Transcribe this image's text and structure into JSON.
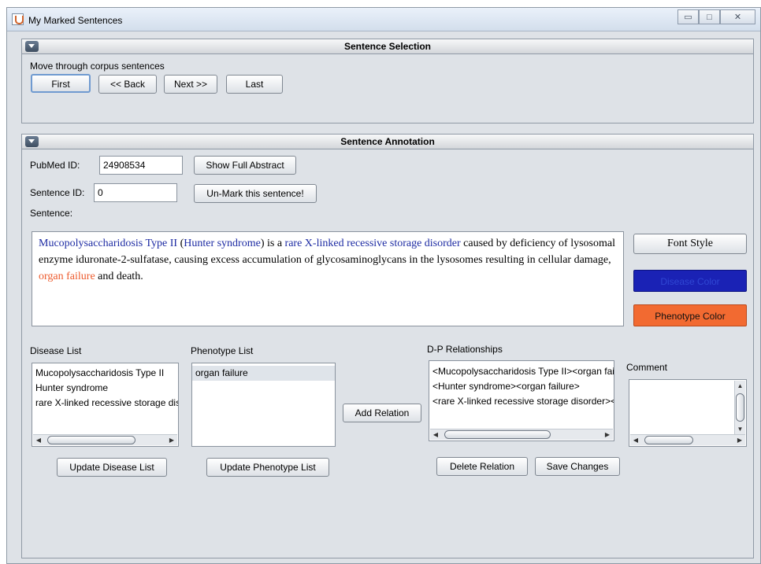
{
  "window": {
    "title": "My Marked Sentences",
    "controls": {
      "minimize": "▭",
      "maximize": "□",
      "close": "✕"
    }
  },
  "sentence_selection": {
    "header": "Sentence Selection",
    "hint": "Move through corpus sentences",
    "buttons": {
      "first": "First",
      "back": "<< Back",
      "next": "Next >>",
      "last": "Last"
    }
  },
  "annotation": {
    "header": "Sentence Annotation",
    "pubmed_label": "PubMed ID:",
    "pubmed_value": "24908534",
    "show_abstract": "Show Full Abstract",
    "sentence_id_label": "Sentence ID:",
    "sentence_id_value": "0",
    "unmark": "Un-Mark this sentence!",
    "sentence_label": "Sentence:",
    "sentence": {
      "s1": "Mucopolysaccharidosis Type II",
      "s2": " (",
      "s3": "Hunter syndrome",
      "s4": ") is a ",
      "s5": "rare X-linked recessive storage disorder",
      "s6": " caused by deficiency of lysosomal enzyme iduronate-2-sulfatase,  causing excess accumulation of glycosaminoglycans in the lysosomes resulting in cellular damage, ",
      "s7": "organ failure",
      "s8": " and death."
    },
    "font_style": "Font Style",
    "disease_color": "Disease Color",
    "phenotype_color": "Phenotype Color",
    "disease_list": {
      "label": "Disease List",
      "items": [
        "Mucopolysaccharidosis Type II",
        "Hunter syndrome",
        "rare X-linked recessive storage disorder"
      ],
      "update": "Update Disease List"
    },
    "phenotype_list": {
      "label": "Phenotype List",
      "items": [
        "organ failure"
      ],
      "update": "Update Phenotype List"
    },
    "add_relation": "Add Relation",
    "relationships": {
      "label": "D-P Relationships",
      "items": [
        "<Mucopolysaccharidosis Type II><organ failure>",
        "<Hunter syndrome><organ failure>",
        "<rare X-linked recessive storage disorder><organ failure>"
      ],
      "delete": "Delete Relation",
      "save": "Save Changes"
    },
    "comment": {
      "label": "Comment",
      "value": ""
    }
  },
  "colors": {
    "disease": "#1a22b5",
    "phenotype": "#f26a31",
    "panel_bg": "#dee2e7"
  },
  "icons": [
    "java-app-icon",
    "minimize-icon",
    "maximize-icon",
    "close-icon",
    "collapse-icon"
  ]
}
